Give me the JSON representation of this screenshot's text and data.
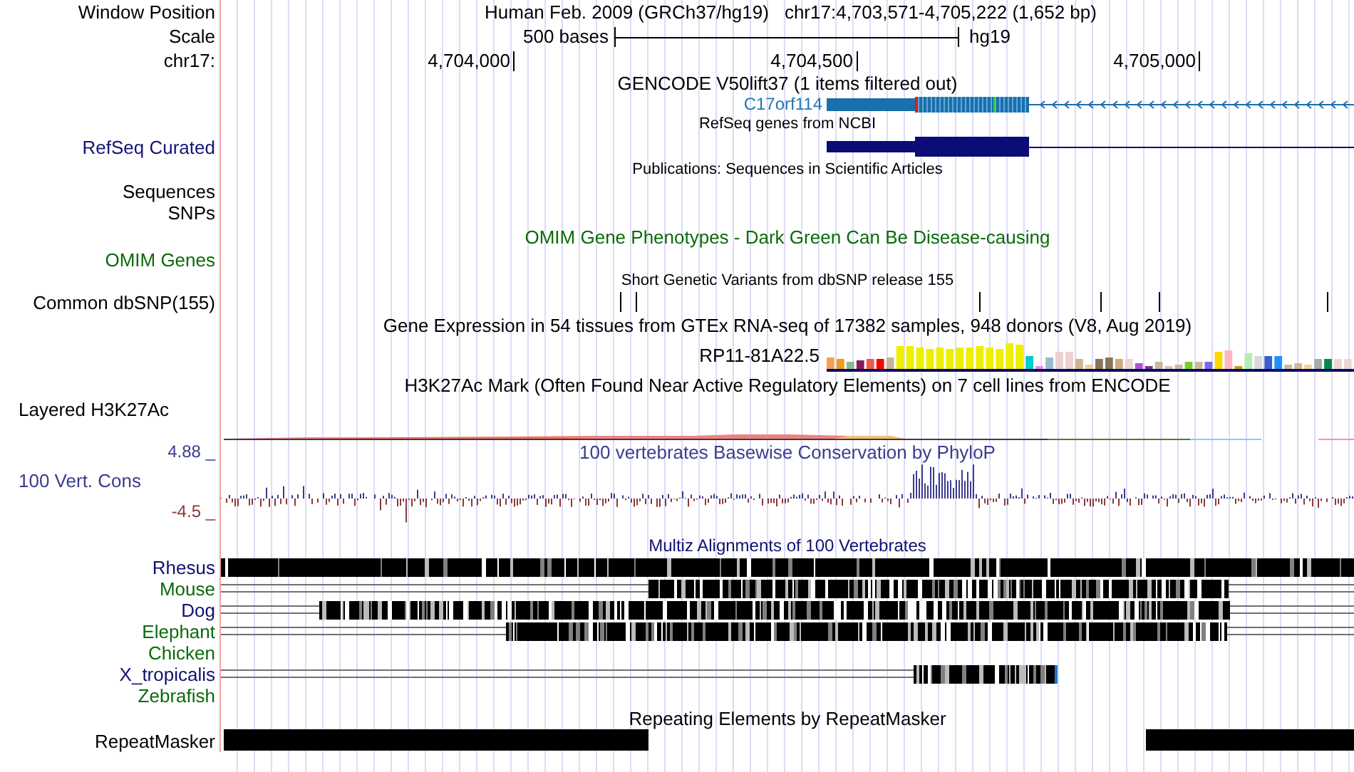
{
  "header": {
    "label": "Window Position",
    "assembly": "Human Feb. 2009 (GRCh37/hg19)",
    "position": "chr17:4,703,571-4,705,222 (1,652 bp)"
  },
  "scale": {
    "label": "Scale",
    "bar_label": "500 bases",
    "db": "hg19"
  },
  "ruler": {
    "label": "chr17:",
    "ticks": [
      "4,704,000",
      "4,704,500",
      "4,705,000"
    ]
  },
  "tracks": [
    {
      "kind": "gencode",
      "title": "GENCODE V50lift37 (1 items filtered out)",
      "gene": "C17orf114"
    },
    {
      "kind": "refseq",
      "title": "RefSeq genes from NCBI",
      "label": "RefSeq Curated"
    },
    {
      "kind": "empty",
      "title": "Publications: Sequences in Scientific Articles"
    },
    {
      "kind": "label",
      "label": "Sequences"
    },
    {
      "kind": "label",
      "label": "SNPs"
    },
    {
      "kind": "omim",
      "title": "OMIM Gene Phenotypes - Dark Green Can Be Disease-causing",
      "label": "OMIM Genes"
    },
    {
      "kind": "snp",
      "title": "Short Genetic Variants from dbSNP release 155",
      "label": "Common dbSNP(155)"
    },
    {
      "kind": "gtex",
      "title": "Gene Expression in 54 tissues from GTEx RNA-seq of 17382 samples, 948 donors (V8, Aug 2019)",
      "gene": "RP11-81A22.5"
    },
    {
      "kind": "h3k27ac",
      "title": "H3K27Ac Mark (Often Found Near Active Regulatory Elements) on 7 cell lines from ENCODE",
      "label": "Layered H3K27Ac"
    },
    {
      "kind": "phylop",
      "title": "100 vertebrates Basewise Conservation by PhyloP",
      "label": "100 Vert. Cons",
      "max": "4.88 _",
      "min": "-4.5 _"
    },
    {
      "kind": "multiz",
      "title": "Multiz Alignments of 100 Vertebrates",
      "species": [
        {
          "name": "Rhesus",
          "color": "#101070"
        },
        {
          "name": "Mouse",
          "color": "#0a6a0a"
        },
        {
          "name": "Dog",
          "color": "#101070"
        },
        {
          "name": "Elephant",
          "color": "#0a6a0a"
        },
        {
          "name": "Chicken",
          "color": "#0a6a0a"
        },
        {
          "name": "X_tropicalis",
          "color": "#101070"
        },
        {
          "name": "Zebrafish",
          "color": "#0a6a0a"
        }
      ]
    },
    {
      "kind": "repeat",
      "title": "Repeating Elements by RepeatMasker",
      "label": "RepeatMasker"
    }
  ]
}
